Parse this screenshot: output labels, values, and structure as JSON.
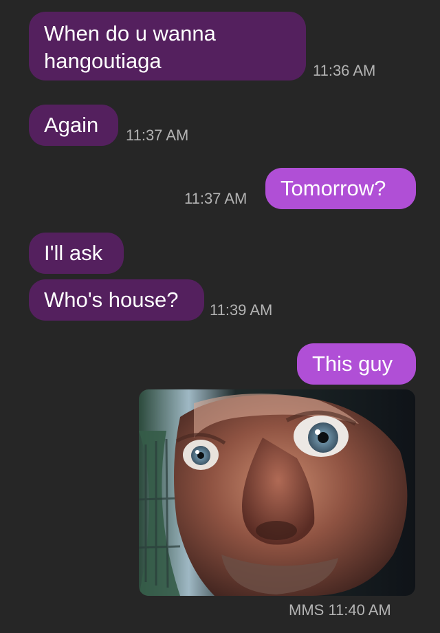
{
  "messages": [
    {
      "direction": "incoming",
      "text": "When do u wanna\nhangoutiaga",
      "time": "11:36 AM"
    },
    {
      "direction": "incoming",
      "text": "Again",
      "time": "11:37 AM"
    },
    {
      "direction": "outgoing",
      "text": "Tomorrow?",
      "time": "11:37 AM"
    },
    {
      "direction": "incoming",
      "text": "I'll ask",
      "time": ""
    },
    {
      "direction": "incoming",
      "text": "Who's house?",
      "time": "11:39 AM"
    },
    {
      "direction": "outgoing",
      "text": "This guy",
      "time": ""
    },
    {
      "direction": "outgoing",
      "type": "image",
      "image_subject": "fisheye close-up of a wide-eyed man's face",
      "time": "MMS 11:40 AM"
    }
  ],
  "colors": {
    "background": "#262626",
    "incoming_bubble": "#54205e",
    "outgoing_bubble": "#b04fd6",
    "text": "#ffffff",
    "timestamp": "#b3b3b3"
  }
}
